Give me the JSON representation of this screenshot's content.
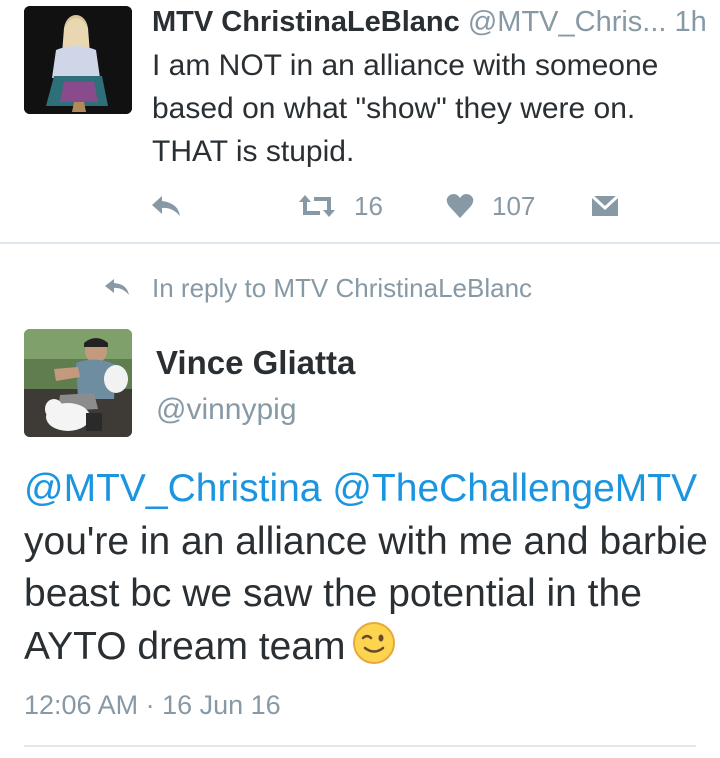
{
  "tweet1": {
    "author_name": "MTV ChristinaLeBlanc",
    "author_handle": "@MTV_Chris...",
    "time": "1h",
    "text": "I am NOT in an alliance with someone based on what \"show\" they were on. THAT is stupid.",
    "retweet_count": "16",
    "like_count": "107"
  },
  "reply_context": {
    "label": "In reply to MTV ChristinaLeBlanc"
  },
  "tweet2": {
    "author_name": "Vince Gliatta",
    "author_handle": "@vinnypig",
    "mention1": "@MTV_Christina",
    "mention2": "@TheChallengeMTV",
    "text": "you're in an alliance with me and barbie beast bc we saw the potential in the AYTO dream team",
    "emoji": "winking-smiley-face",
    "timestamp": "12:06 AM · 16 Jun 16"
  },
  "colors": {
    "text": "#292f33",
    "muted": "#8899a6",
    "link": "#1b95e0",
    "divider": "#e1e8ed"
  },
  "icons": [
    "reply-icon",
    "retweet-icon",
    "like-icon",
    "direct-message-icon",
    "reply-arrow-icon",
    "wink-emoji-icon"
  ]
}
